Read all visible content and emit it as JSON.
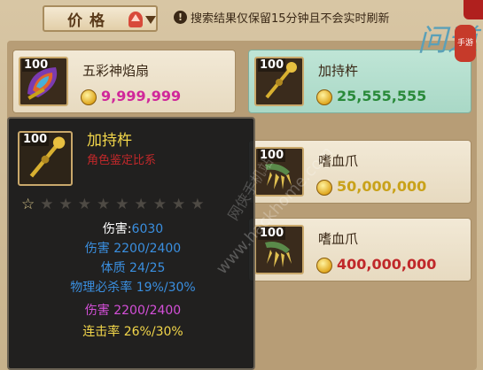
{
  "header": {
    "sort_label": "价格",
    "notice_icon": "!",
    "notice": "搜索结果仅保留15分钟且不会实时刷新"
  },
  "logo": {
    "text": "问道",
    "tag": "手游"
  },
  "items": [
    {
      "qty": "100",
      "name": "五彩神焰扇",
      "price": "9,999,999",
      "price_color": "#d0289a",
      "icon": "fan-icon"
    },
    {
      "qty": "100",
      "name": "加持杵",
      "price": "25,555,555",
      "price_color": "#2a8a3a",
      "icon": "pestle-icon"
    },
    {
      "qty": "100",
      "name": "嗜血爪",
      "price": "50,000,000",
      "price_color": "#c9a21a",
      "icon": "claw-icon"
    },
    {
      "qty": "100",
      "name": "嗜血爪",
      "price": "400,000,000",
      "price_color": "#c0282a",
      "icon": "claw-icon"
    }
  ],
  "tooltip": {
    "qty": "100",
    "name": "加持杵",
    "subtitle": "角色鉴定比系",
    "stars_total": 10,
    "stars_filled": 1,
    "lines": [
      {
        "label": "伤害:",
        "value": "6030",
        "label_color": "#ffffff",
        "value_color": "#3a8fe0"
      },
      {
        "text": "伤害 2200/2400",
        "color": "#3a8fe0"
      },
      {
        "text": "体质 24/25",
        "color": "#3a8fe0"
      },
      {
        "text": "物理必杀率 19%/30%",
        "color": "#3a8fe0"
      },
      {
        "text": "伤害 2200/2400",
        "color": "#d44fd8"
      },
      {
        "text": "连击率 26%/30%",
        "color": "#f2d64a"
      }
    ]
  },
  "watermark": "网侠手机站",
  "watermark_url": "www.hackhome.com"
}
